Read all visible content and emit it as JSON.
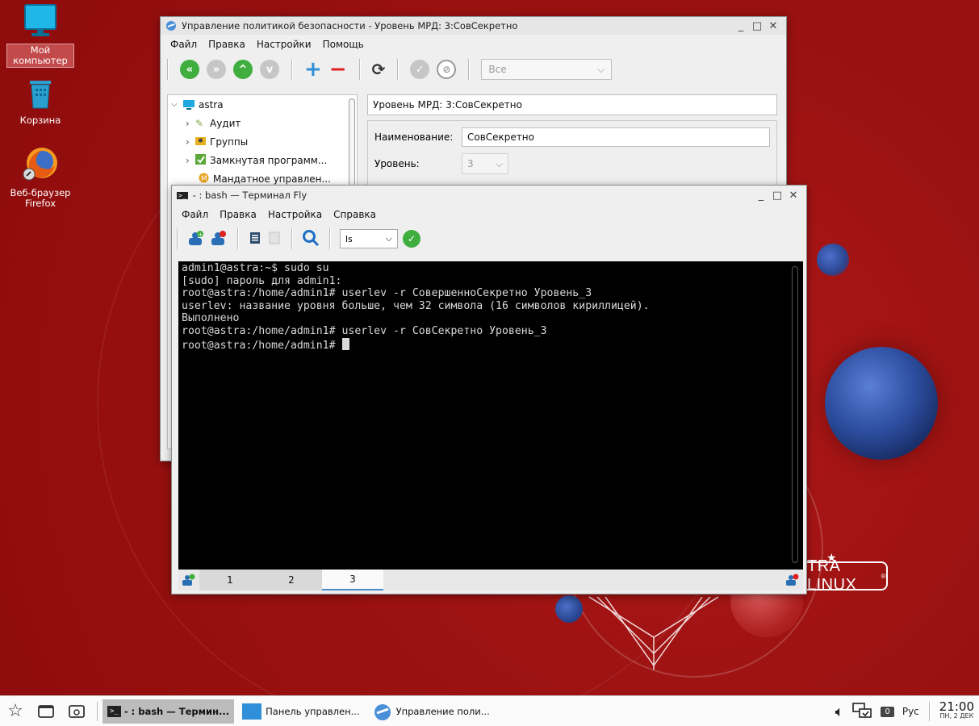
{
  "desktop": {
    "icons": [
      {
        "label": "Мой компьютер",
        "icon": "monitor-icon"
      },
      {
        "label": "Корзина",
        "icon": "trash-icon"
      },
      {
        "label": "Веб-браузер Firefox",
        "icon": "firefox-icon"
      }
    ],
    "logo_text": "TRA LINUX"
  },
  "security_window": {
    "title": "Управление политикой безопасности - Уровень МРД: 3:СовСекретно",
    "menu": [
      "Файл",
      "Правка",
      "Настройки",
      "Помощь"
    ],
    "filter_select": "Все",
    "tree": {
      "root": "astra",
      "items": [
        "Аудит",
        "Группы",
        "Замкнутая программ...",
        "Мандатное управлен..."
      ]
    },
    "panel_header": "Уровень МРД: 3:СовСекретно",
    "name_label": "Наименование:",
    "name_value": "СовСекретно",
    "level_label": "Уровень:",
    "level_value": "3"
  },
  "terminal_window": {
    "title": "- : bash — Терминал Fly",
    "menu": [
      "Файл",
      "Правка",
      "Настройка",
      "Справка"
    ],
    "command_select": "ls",
    "lines": [
      "admin1@astra:~$ sudo su",
      "[sudo] пароль для admin1:",
      "root@astra:/home/admin1# userlev -r СовершенноСекретно Уровень_3",
      "userlev: название уровня больше, чем 32 символа (16 символов кириллицей).",
      "Выполнено",
      "root@astra:/home/admin1# userlev -r СовСекретно Уровень_3",
      "root@astra:/home/admin1# "
    ],
    "tabs": [
      "1",
      "2",
      "3"
    ],
    "active_tab": "3"
  },
  "taskbar": {
    "tasks": [
      {
        "label": "- : bash — Термин...",
        "icon": "terminal-icon",
        "active": true
      },
      {
        "label": "Панель управлен...",
        "icon": "control-panel-icon",
        "active": false
      },
      {
        "label": "Управление поли...",
        "icon": "security-shield-icon",
        "active": false
      }
    ],
    "workspace": "0",
    "layout": "Рус",
    "time": "21:00",
    "date": "ПН, 2 ДЕК"
  },
  "colors": {
    "desktop_bg": "#9d1212",
    "accent_green": "#3fae3f",
    "accent_blue": "#2f8fd8"
  }
}
